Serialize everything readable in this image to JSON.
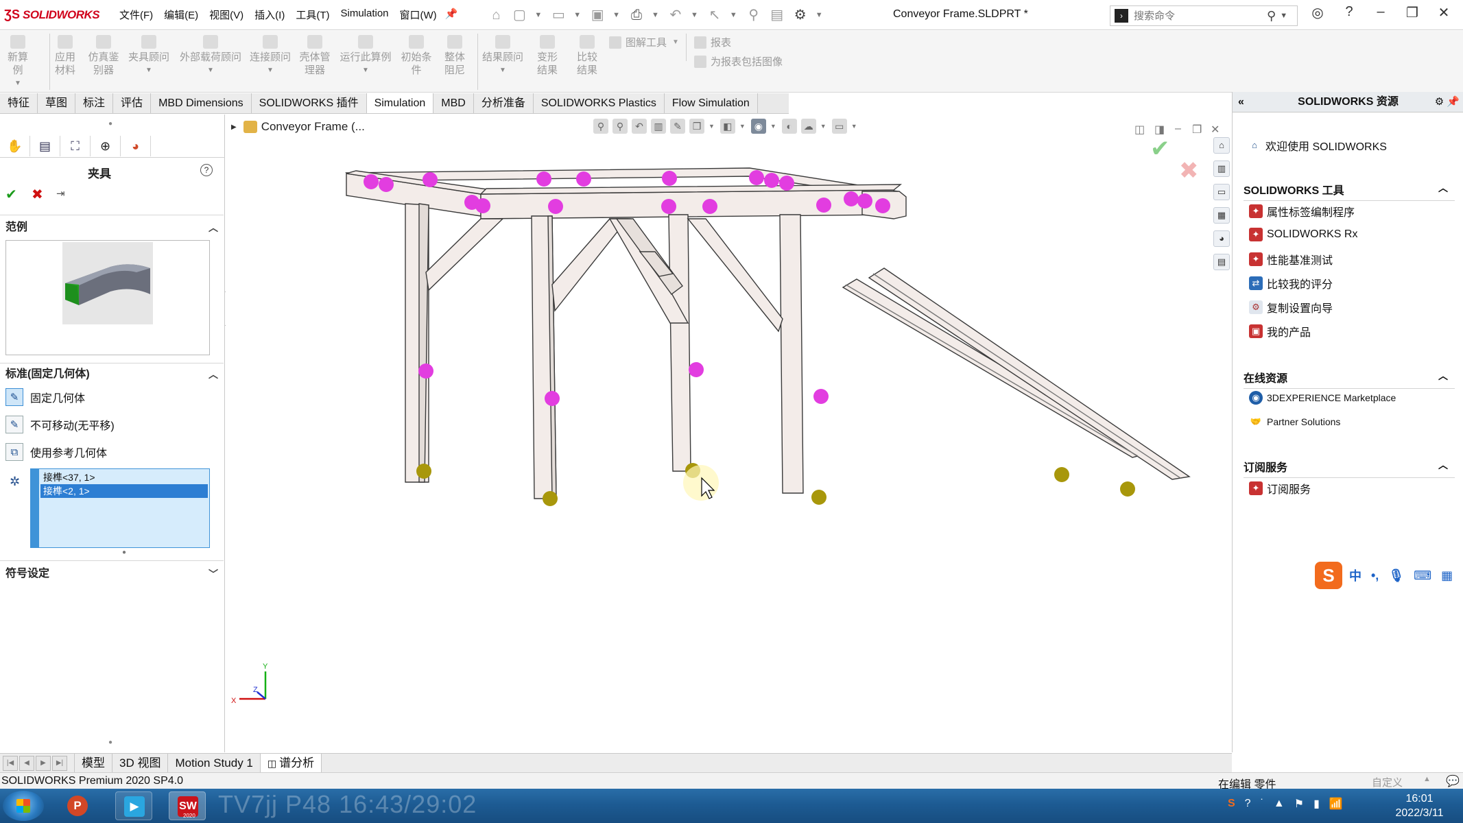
{
  "app": {
    "brand": "SOLIDWORKS",
    "doc_title": "Conveyor Frame.SLDPRT *"
  },
  "menu": {
    "items": [
      "文件(F)",
      "编辑(E)",
      "视图(V)",
      "插入(I)",
      "工具(T)",
      "Simulation",
      "窗口(W)"
    ]
  },
  "search": {
    "placeholder": "搜索命令"
  },
  "ribbon": {
    "tools": [
      {
        "label": "新算例",
        "icon": "new-study-icon"
      },
      {
        "label": "应用材料",
        "icon": "apply-material-icon"
      },
      {
        "label": "仿真鉴别器",
        "icon": "simulation-evaluator-icon"
      },
      {
        "label": "夹具顾问",
        "icon": "fixtures-advisor-icon"
      },
      {
        "label": "外部载荷顾问",
        "icon": "external-loads-icon"
      },
      {
        "label": "连接顾问",
        "icon": "connections-advisor-icon"
      },
      {
        "label": "壳体管理器",
        "icon": "shell-manager-icon"
      },
      {
        "label": "运行此算例",
        "icon": "run-study-icon"
      },
      {
        "label": "初始条件",
        "icon": "initial-condition-icon"
      },
      {
        "label": "整体阻尼",
        "icon": "global-damping-icon"
      },
      {
        "label": "结果顾问",
        "icon": "results-advisor-icon"
      },
      {
        "label": "变形结果",
        "icon": "deformed-result-icon"
      },
      {
        "label": "比较结果",
        "icon": "compare-results-icon"
      }
    ],
    "plot_tools": "图解工具",
    "report": "报表",
    "include_image": "为报表包括图像"
  },
  "tabs": [
    "特征",
    "草图",
    "标注",
    "评估",
    "MBD Dimensions",
    "SOLIDWORKS 插件",
    "Simulation",
    "MBD",
    "分析准备",
    "SOLIDWORKS Plastics",
    "Flow Simulation"
  ],
  "active_tab": "Simulation",
  "property_manager": {
    "title": "夹具",
    "example_header": "范例",
    "standard_header": "标准(固定几何体)",
    "options": [
      "固定几何体",
      "不可移动(无平移)",
      "使用参考几何体"
    ],
    "selections": [
      "接榫<37, 1>",
      "接榫<2, 1>"
    ],
    "symbol_header": "符号设定"
  },
  "viewport": {
    "tree_label": "Conveyor Frame  (...",
    "triad": {
      "x": "X",
      "y": "Y",
      "z": "Z"
    }
  },
  "task_pane": {
    "title": "SOLIDWORKS 资源",
    "welcome": "欢迎使用 SOLIDWORKS",
    "tools_header": "SOLIDWORKS 工具",
    "tools": [
      "属性标签编制程序",
      "SOLIDWORKS Rx",
      "性能基准测试",
      "比较我的评分",
      "复制设置向导",
      "我的产品"
    ],
    "online_header": "在线资源",
    "online": [
      "3DEXPERIENCE Marketplace",
      "Partner Solutions"
    ],
    "subscription_header": "订阅服务",
    "subscription": [
      "订阅服务"
    ],
    "ime": {
      "chinese": "中"
    }
  },
  "bottom_tabs": [
    "模型",
    "3D 视图",
    "Motion Study 1",
    "谱分析"
  ],
  "status": {
    "version": "SOLIDWORKS Premium 2020 SP4.0",
    "mode": "在编辑 零件",
    "custom": "自定义"
  },
  "taskbar": {
    "watermark": "TV7jj P48 16:43/29:02",
    "time": "16:01",
    "date": "2022/3/11",
    "sw_badge": "2020"
  }
}
